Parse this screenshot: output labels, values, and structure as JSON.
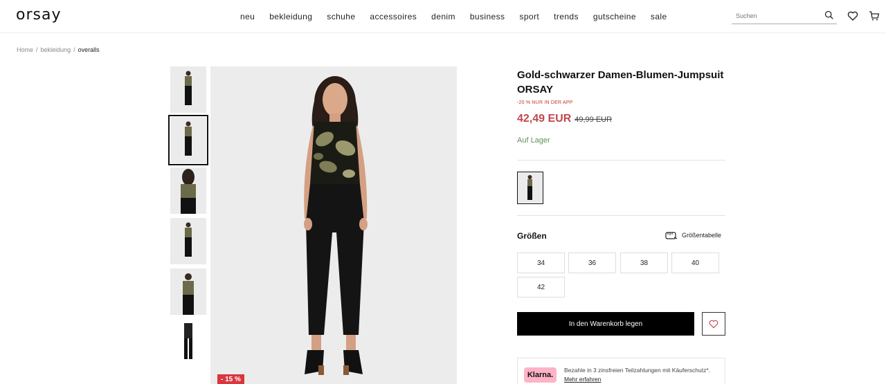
{
  "header": {
    "logo": "orsay",
    "nav": [
      "neu",
      "bekleidung",
      "schuhe",
      "accessoires",
      "denim",
      "business",
      "sport",
      "trends",
      "gutscheine",
      "sale"
    ],
    "search_placeholder": "Suchen"
  },
  "breadcrumb": {
    "items": [
      "Home",
      "bekleidung"
    ],
    "current": "overalls"
  },
  "gallery": {
    "discount_badge": "- 15 %"
  },
  "product": {
    "title": "Gold-schwarzer Damen-Blumen-Jumpsuit ORSAY",
    "promo": "-20 % NUR IN DER APP",
    "price": "42,49 EUR",
    "old_price": "49,99 EUR",
    "stock": "Auf Lager",
    "sizes_label": "Größen",
    "size_table_label": "Größentabelle",
    "sizes": [
      "34",
      "36",
      "38",
      "40",
      "42"
    ],
    "cart_label": "In den Warenkorb legen"
  },
  "klarna": {
    "logo": "Klarna.",
    "text": "Bezahle in 3 zinsfreien Teilzahlungen mit Käuferschutz*.",
    "link": "Mehr erfahren"
  },
  "colors": {
    "accent_price": "#c0474c",
    "promo_red": "#c0392b",
    "stock_green": "#5f8f5a",
    "klarna_pink": "#ffb3c7"
  }
}
